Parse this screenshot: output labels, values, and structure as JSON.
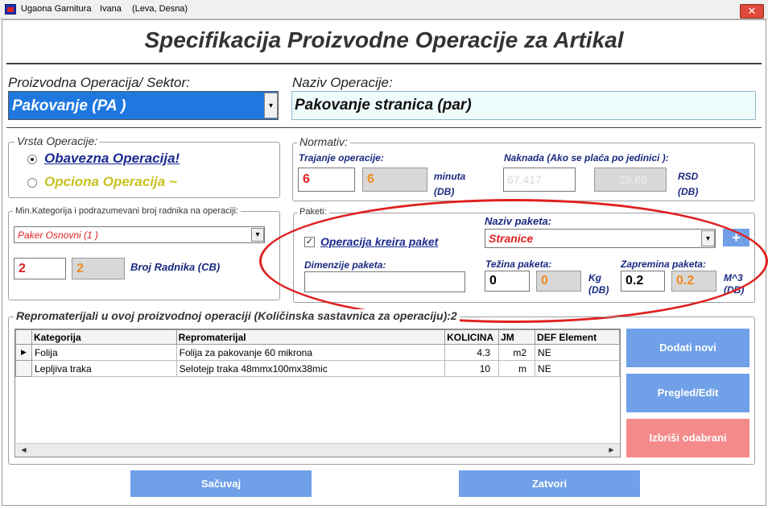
{
  "titlebar": {
    "app": "Ugaona Garnitura",
    "user": "Ivana",
    "variant": "(Leva, Desna)",
    "close_glyph": "✕"
  },
  "page_title": "Specifikacija Proizvodne Operacije za Artikal",
  "operacija": {
    "label": "Proizvodna Operacija/ Sektor:",
    "selected": "Pakovanje (PA )",
    "dropdown_glyph": "▾"
  },
  "naziv": {
    "label": "Naziv Operacije:",
    "value": "Pakovanje stranica (par)"
  },
  "vrsta": {
    "legend": "Vrsta Operacije:",
    "option1": "Obavezna Operacija!",
    "option2": "Opciona Operacija ~"
  },
  "normativ": {
    "legend": "Normativ:",
    "trajanje_label": "Trajanje operacije:",
    "trajanje_value": "6",
    "trajanje_db": "6",
    "minuta_label": "minuta",
    "db_label": "(DB)",
    "naknada_label": "Naknada (Ako se plaća po jedinici ):",
    "naknada_value": "67,417",
    "naknada_db": "29,66",
    "rsd_label": "RSD",
    "rsd_db": "(DB)"
  },
  "radnik": {
    "legend": "Min.Kategorija i podrazumevani broj radnika na operaciji:",
    "kategorija": "Paker Osnovni (1 )",
    "broj": "2",
    "broj_db": "2",
    "broj_label": "Broj Radnika (CB)"
  },
  "paketi": {
    "legend": "Paketi:",
    "check_label": "Operacija kreira paket",
    "naziv_label": "Naziv paketa:",
    "naziv_value": "Stranice",
    "add_glyph": "+",
    "dimenzije_label": "Dimenzije paketa:",
    "dimenzije_value": "",
    "tezina_label": "Težina paketa:",
    "tezina_value": "0",
    "tezina_db": "0",
    "kg_label": "Kg",
    "kg_db": "(DB)",
    "zapremina_label": "Zapremina paketa:",
    "zapremina_value": "0.2",
    "zapremina_db": "0.2",
    "m3_label": "M^3",
    "m3_db": "(DB)"
  },
  "repromaterijali": {
    "legend": "Repromaterijali u ovoj proizvodnoj operaciji (Količinska sastavnica za operaciju):2",
    "columns": [
      "Kategorija",
      "Repromaterijal",
      "KOLICINA",
      "JM",
      "DEF Element"
    ],
    "rows": [
      {
        "kategorija": "Folija",
        "repromaterijal": "Folija za pakovanje  60 mikrona",
        "kolicina": "4.3",
        "jm": "m2",
        "def": "NE"
      },
      {
        "kategorija": "Lepljiva traka",
        "repromaterijal": "Selotejp traka 48mmx100mx38mic",
        "kolicina": "10",
        "jm": "m",
        "def": "NE"
      }
    ],
    "row_pointer": "▶",
    "scroll_left": "◀",
    "scroll_right": "▶"
  },
  "buttons": {
    "dodati": "Dodati novi",
    "pregled": "Pregled/Edit",
    "izbrisi": "Izbriši odabrani",
    "sacuvaj": "Sačuvaj",
    "zatvori": "Zatvori"
  },
  "colors": {
    "accent_blue": "#6fa0e8",
    "combo_blue": "#1e78e0",
    "danger": "#f58a8a",
    "highlight_ellipse": "#e02020"
  }
}
